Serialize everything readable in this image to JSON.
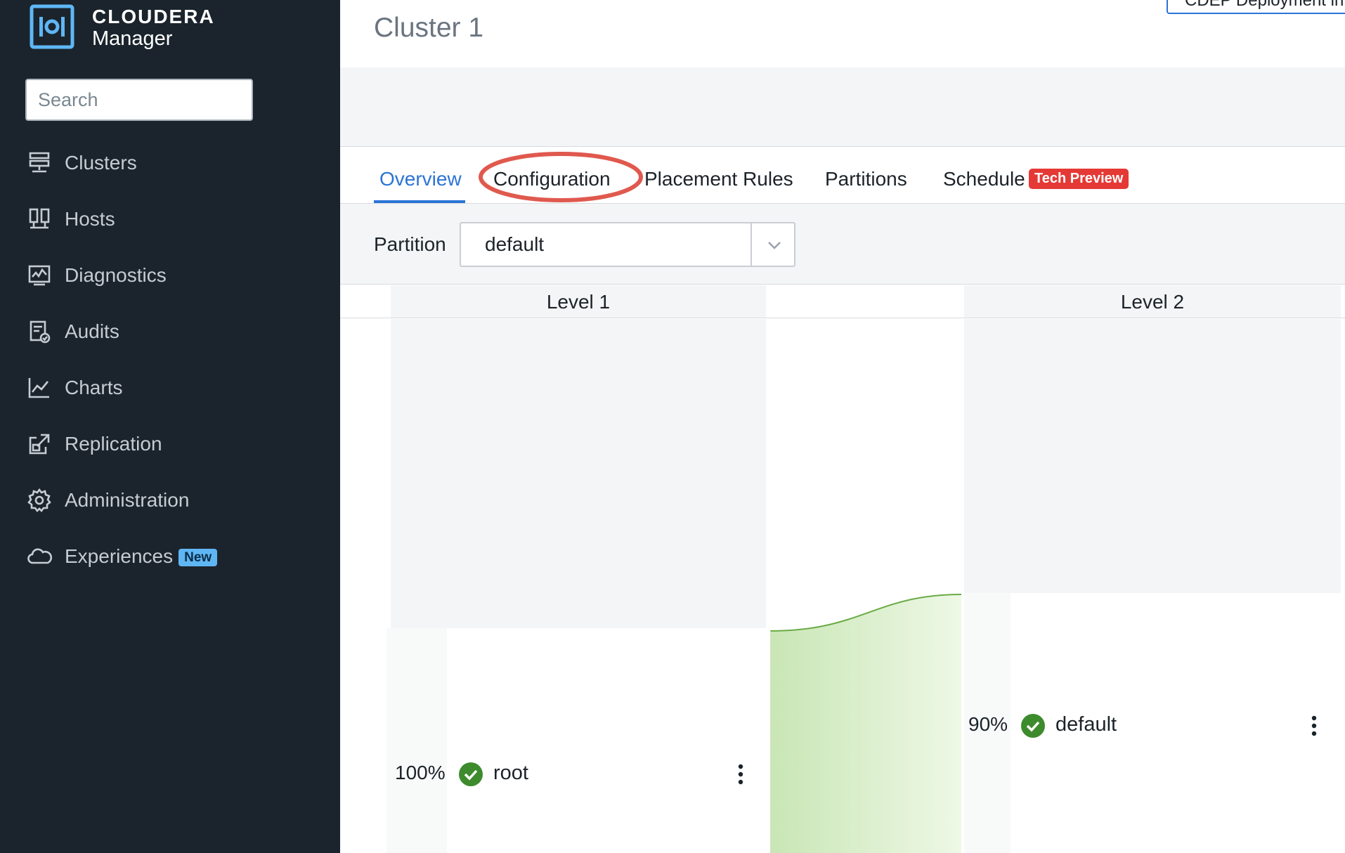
{
  "brand": {
    "line1": "CLOUDERA",
    "line2": "Manager"
  },
  "search": {
    "placeholder": "Search"
  },
  "nav": {
    "items": [
      {
        "label": "Clusters",
        "icon": "clusters-icon"
      },
      {
        "label": "Hosts",
        "icon": "hosts-icon"
      },
      {
        "label": "Diagnostics",
        "icon": "diagnostics-icon"
      },
      {
        "label": "Audits",
        "icon": "audits-icon"
      },
      {
        "label": "Charts",
        "icon": "charts-icon"
      },
      {
        "label": "Replication",
        "icon": "replication-icon"
      },
      {
        "label": "Administration",
        "icon": "gear-icon"
      },
      {
        "label": "Experiences",
        "icon": "cloud-icon",
        "badge": "New"
      }
    ]
  },
  "page": {
    "title": "Cluster 1",
    "top_button": "CDEP Deployment in"
  },
  "tabs": [
    {
      "label": "Overview",
      "active": true
    },
    {
      "label": "Configuration",
      "highlighted": true
    },
    {
      "label": "Placement Rules"
    },
    {
      "label": "Partitions"
    },
    {
      "label": "Schedule",
      "badge": "Tech Preview"
    }
  ],
  "filter": {
    "label": "Partition",
    "value": "default"
  },
  "levels": [
    {
      "label": "Level 1"
    },
    {
      "label": "Level 2"
    }
  ],
  "queues": {
    "root": {
      "percent": "100%",
      "name": "root",
      "capacity": 100
    },
    "default": {
      "percent": "90%",
      "name": "default",
      "capacity": 90
    }
  },
  "colors": {
    "accent": "#2a74d6",
    "sidebar_bg": "#1b242c",
    "tech_badge": "#e53935",
    "new_badge": "#5fb6f5",
    "ok": "#3d8b2d",
    "highlight": "#e0594e"
  }
}
